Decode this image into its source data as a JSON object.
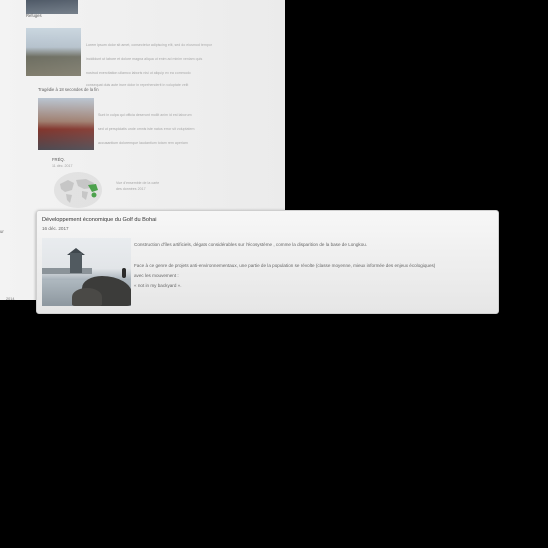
{
  "background_page": {
    "section_top": "Refuges",
    "item1_lines": [
      "Lorem ipsum dolor sit amet, consectetur adipiscing elit, sed do eiusmod tempor",
      "incididunt ut labore et dolore magna aliqua ut enim ad minim veniam quis",
      "nostrud exercitation ullamco laboris nisi ut aliquip ex ea commodo",
      "consequat duis aute irure dolor in reprehenderit in voluptate velit"
    ],
    "section_mid": "Tragédie à 18 secondes de la fin",
    "item2_lines": [
      "Sunt in culpa qui officia deserunt mollit anim id est laborum",
      "sed ut perspiciatis unde omnis iste natus error sit voluptatem",
      "accusantium doloremque laudantium totam rem aperiam"
    ],
    "map_title": "FRÉQ.",
    "map_date": "11 déc. 2017",
    "map_lines": [
      "Vue d'ensemble de la carte",
      "des données 2017"
    ]
  },
  "card": {
    "title": "Développement économique du Golf du Bohai",
    "date": "16 déc. 2017",
    "paragraph1": "Construction d'îles artificiels, dégats considérables sur l'écosystème , comme la disparition de la base de Longkou.",
    "paragraph2": "Face à ce genre de projets anti-environnementaux, une partie de la population se révolte (classe moyenne, mieux informée des enjeux écologiques)",
    "paragraph3": "avec les mouvement :",
    "paragraph4": "« not in my backyard »."
  },
  "left_edge": {
    "line1": "ur",
    "line2": "2014"
  }
}
